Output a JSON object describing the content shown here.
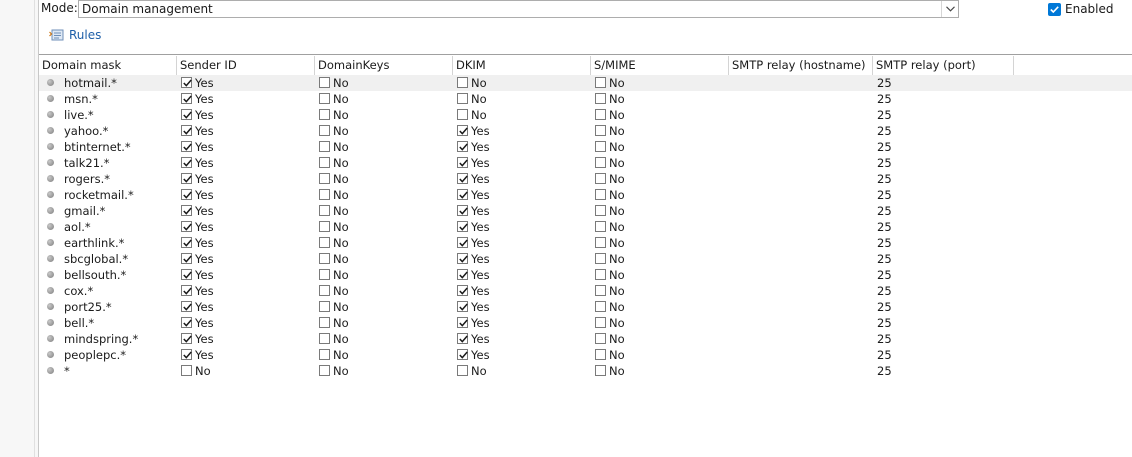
{
  "mode": {
    "label": "Mode:",
    "value": "Domain management"
  },
  "enabled": {
    "label": "Enabled",
    "checked": true
  },
  "toolbar": {
    "rules_label": "Rules"
  },
  "columns": [
    "Domain mask",
    "Sender ID",
    "DomainKeys",
    "DKIM",
    "S/MIME",
    "SMTP relay (hostname)",
    "SMTP relay (port)"
  ],
  "rows": [
    {
      "mask": "hotmail.*",
      "sender_id": "Yes",
      "domainkeys": "No",
      "dkim": "No",
      "smime": "No",
      "relay_host": "",
      "relay_port": "25"
    },
    {
      "mask": "msn.*",
      "sender_id": "Yes",
      "domainkeys": "No",
      "dkim": "No",
      "smime": "No",
      "relay_host": "",
      "relay_port": "25"
    },
    {
      "mask": "live.*",
      "sender_id": "Yes",
      "domainkeys": "No",
      "dkim": "No",
      "smime": "No",
      "relay_host": "",
      "relay_port": "25"
    },
    {
      "mask": "yahoo.*",
      "sender_id": "Yes",
      "domainkeys": "No",
      "dkim": "Yes",
      "smime": "No",
      "relay_host": "",
      "relay_port": "25"
    },
    {
      "mask": "btinternet.*",
      "sender_id": "Yes",
      "domainkeys": "No",
      "dkim": "Yes",
      "smime": "No",
      "relay_host": "",
      "relay_port": "25"
    },
    {
      "mask": "talk21.*",
      "sender_id": "Yes",
      "domainkeys": "No",
      "dkim": "Yes",
      "smime": "No",
      "relay_host": "",
      "relay_port": "25"
    },
    {
      "mask": "rogers.*",
      "sender_id": "Yes",
      "domainkeys": "No",
      "dkim": "Yes",
      "smime": "No",
      "relay_host": "",
      "relay_port": "25"
    },
    {
      "mask": "rocketmail.*",
      "sender_id": "Yes",
      "domainkeys": "No",
      "dkim": "Yes",
      "smime": "No",
      "relay_host": "",
      "relay_port": "25"
    },
    {
      "mask": "gmail.*",
      "sender_id": "Yes",
      "domainkeys": "No",
      "dkim": "Yes",
      "smime": "No",
      "relay_host": "",
      "relay_port": "25"
    },
    {
      "mask": "aol.*",
      "sender_id": "Yes",
      "domainkeys": "No",
      "dkim": "Yes",
      "smime": "No",
      "relay_host": "",
      "relay_port": "25"
    },
    {
      "mask": "earthlink.*",
      "sender_id": "Yes",
      "domainkeys": "No",
      "dkim": "Yes",
      "smime": "No",
      "relay_host": "",
      "relay_port": "25"
    },
    {
      "mask": "sbcglobal.*",
      "sender_id": "Yes",
      "domainkeys": "No",
      "dkim": "Yes",
      "smime": "No",
      "relay_host": "",
      "relay_port": "25"
    },
    {
      "mask": "bellsouth.*",
      "sender_id": "Yes",
      "domainkeys": "No",
      "dkim": "Yes",
      "smime": "No",
      "relay_host": "",
      "relay_port": "25"
    },
    {
      "mask": "cox.*",
      "sender_id": "Yes",
      "domainkeys": "No",
      "dkim": "Yes",
      "smime": "No",
      "relay_host": "",
      "relay_port": "25"
    },
    {
      "mask": "port25.*",
      "sender_id": "Yes",
      "domainkeys": "No",
      "dkim": "Yes",
      "smime": "No",
      "relay_host": "",
      "relay_port": "25"
    },
    {
      "mask": "bell.*",
      "sender_id": "Yes",
      "domainkeys": "No",
      "dkim": "Yes",
      "smime": "No",
      "relay_host": "",
      "relay_port": "25"
    },
    {
      "mask": "mindspring.*",
      "sender_id": "Yes",
      "domainkeys": "No",
      "dkim": "Yes",
      "smime": "No",
      "relay_host": "",
      "relay_port": "25"
    },
    {
      "mask": "peoplepc.*",
      "sender_id": "Yes",
      "domainkeys": "No",
      "dkim": "Yes",
      "smime": "No",
      "relay_host": "",
      "relay_port": "25"
    },
    {
      "mask": "*",
      "sender_id": "No",
      "domainkeys": "No",
      "dkim": "No",
      "smime": "No",
      "relay_host": "",
      "relay_port": "25"
    }
  ],
  "colors": {
    "accent": "#0078d7",
    "link": "#1e5fa8",
    "selected_row": "#f0f0f0"
  },
  "icons": {
    "rules": "rules-icon",
    "dropdown": "chevron-down-icon",
    "bullet": "row-bullet-icon",
    "check": "check-icon"
  }
}
